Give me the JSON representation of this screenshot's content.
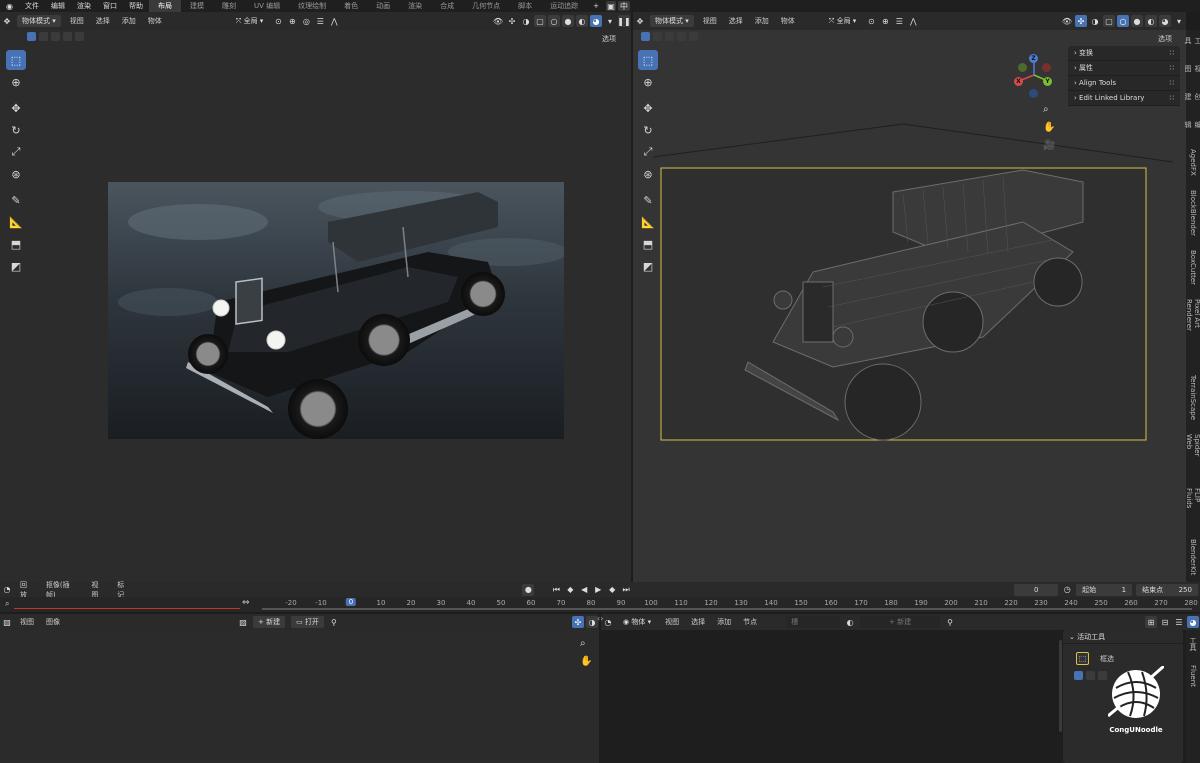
{
  "topbar": {
    "menus": [
      "文件",
      "编辑",
      "渲染",
      "窗口",
      "帮助"
    ],
    "workspaces": [
      "布局",
      "建模",
      "雕刻",
      "UV 编辑",
      "纹理绘制",
      "着色",
      "动画",
      "渲染",
      "合成",
      "几何节点",
      "脚本",
      "运动追踪"
    ],
    "active_workspace_index": 0,
    "plus": "+",
    "lang": "中"
  },
  "left_viewport": {
    "mode": "物体模式",
    "menus": [
      "视图",
      "选择",
      "添加",
      "物体"
    ],
    "orientation": "全局",
    "options": "选项"
  },
  "right_viewport": {
    "mode": "物体模式",
    "menus": [
      "视图",
      "选择",
      "添加",
      "物体"
    ],
    "orientation": "全局",
    "options": "选项",
    "npanel_rows": [
      "变换",
      "属性",
      "Align Tools",
      "Edit Linked Library"
    ],
    "side_tabs": [
      "工具",
      "视图",
      "创建",
      "编辑",
      "AgedFX",
      "BlockBlender",
      "BoxCutter",
      "Pixel Art Renderer",
      "TerrainScape",
      "Spider Web",
      "FLIP Fluids",
      "BlenderKit"
    ],
    "gizmo": {
      "z": "Z",
      "x": "X",
      "y": "Y"
    }
  },
  "timeline": {
    "menus": [
      "回放",
      "抠像(插帧)",
      "视图",
      "标记"
    ],
    "current_frame": "0",
    "start_label": "起始",
    "start": "1",
    "end_label": "结束点",
    "end": "250",
    "ticks": [
      "-20",
      "-10",
      "0",
      "10",
      "20",
      "30",
      "40",
      "50",
      "60",
      "70",
      "80",
      "90",
      "100",
      "110",
      "120",
      "130",
      "140",
      "150",
      "160",
      "170",
      "180",
      "190",
      "200",
      "210",
      "220",
      "230",
      "240",
      "250",
      "260",
      "270",
      "280"
    ]
  },
  "image_editor": {
    "menus": [
      "视图",
      "图像"
    ],
    "new_label": "新建",
    "open_label": "打开"
  },
  "node_editor": {
    "object_label": "物体",
    "menus": [
      "视图",
      "选择",
      "添加",
      "节点"
    ],
    "slot": "槽",
    "new_label": "新建"
  },
  "tool_panel": {
    "title": "活动工具",
    "tool": "框选",
    "side_tab": "工具",
    "side_tab2": "Fluent"
  },
  "watermark": {
    "text": "CongUNoodle"
  },
  "colors": {
    "accent": "#4772b3",
    "selection": "#d8c24a"
  }
}
